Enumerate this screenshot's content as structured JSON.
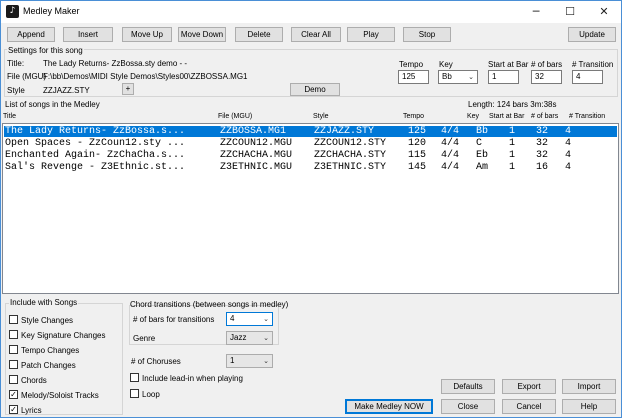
{
  "window": {
    "title": "Medley Maker",
    "app_icon": "medley-maker-app-icon",
    "minimize_glyph": "─",
    "maximize_glyph": "☐",
    "close_glyph": "✕"
  },
  "toolbar": {
    "append": "Append",
    "insert": "Insert",
    "move_up": "Move Up",
    "move_down": "Move Down",
    "delete": "Delete",
    "clear_all": "Clear All",
    "play": "Play",
    "stop": "Stop",
    "update": "Update"
  },
  "settings": {
    "heading": "Settings for this song",
    "title_label": "Title:",
    "title_value": "The Lady Returns- ZzBossa.sty demo - -",
    "file_label": "File (MGU)",
    "file_value": "F:\\bb\\Demos\\MIDI Style Demos\\Styles00\\ZZBOSSA.MG1",
    "style_label": "Style",
    "style_value": "ZZJAZZ.STY",
    "plus_button": "+",
    "demo_button": "Demo",
    "tempo_label": "Tempo",
    "tempo_value": "125",
    "key_label": "Key",
    "key_value": "Bb",
    "start_label": "Start at Bar",
    "start_value": "1",
    "bars_label": "# of bars",
    "bars_value": "32",
    "transition_label": "# Transition",
    "transition_value": "4"
  },
  "list": {
    "heading": "List of songs in the Medley",
    "length_text": "Length:  124 bars  3m:38s",
    "columns": {
      "title": "Title",
      "file": "File (MGU)",
      "style": "Style",
      "tempo": "Tempo",
      "key": "Key",
      "start": "Start at Bar",
      "bars": "# of bars",
      "transition": "# Transition"
    },
    "rows": [
      {
        "title": "The Lady Returns- ZzBossa.s...",
        "file": "ZZBOSSA.MG1",
        "style": "ZZJAZZ.STY",
        "tempo": "125",
        "meter": "4/4",
        "key": "Bb",
        "start": "1",
        "bars": "32",
        "transition": "4"
      },
      {
        "title": "Open Spaces - ZzCoun12.sty ...",
        "file": "ZZCOUN12.MGU",
        "style": "ZZCOUN12.STY",
        "tempo": "120",
        "meter": "4/4",
        "key": "C",
        "start": "1",
        "bars": "32",
        "transition": "4"
      },
      {
        "title": "Enchanted Again- ZzChaCha.s...",
        "file": "ZZCHACHA.MGU",
        "style": "ZZCHACHA.STY",
        "tempo": "115",
        "meter": "4/4",
        "key": "Eb",
        "start": "1",
        "bars": "32",
        "transition": "4"
      },
      {
        "title": "Sal's Revenge - Z3Ethnic.st...",
        "file": "Z3ETHNIC.MGU",
        "style": "Z3ETHNIC.STY",
        "tempo": "145",
        "meter": "4/4",
        "key": "Am",
        "start": "1",
        "bars": "16",
        "transition": "4"
      }
    ]
  },
  "include": {
    "heading": "Include with Songs",
    "items": [
      {
        "label": "Style Changes",
        "checked": false
      },
      {
        "label": "Key Signature Changes",
        "checked": false
      },
      {
        "label": "Tempo Changes",
        "checked": false
      },
      {
        "label": "Patch Changes",
        "checked": false
      },
      {
        "label": "Chords",
        "checked": false
      },
      {
        "label": "Melody/Soloist Tracks",
        "checked": true
      },
      {
        "label": "Lyrics",
        "checked": true
      }
    ]
  },
  "chord_transitions": {
    "heading": "Chord transitions (between songs in medley)",
    "bars_label": "# of bars for transitions",
    "bars_value": "4",
    "genre_label": "Genre",
    "genre_value": "Jazz",
    "choruses_label": "# of Choruses",
    "choruses_value": "1",
    "lead_in_label": "Include lead-in when playing",
    "lead_in_checked": false,
    "loop_label": "Loop",
    "loop_checked": false
  },
  "bottom_buttons": {
    "defaults": "Defaults",
    "export": "Export",
    "import": "Import",
    "make_medley": "Make Medley NOW",
    "close": "Close",
    "cancel": "Cancel",
    "help": "Help"
  },
  "glyphs": {
    "check": "✓",
    "dropdown": "⌄"
  }
}
